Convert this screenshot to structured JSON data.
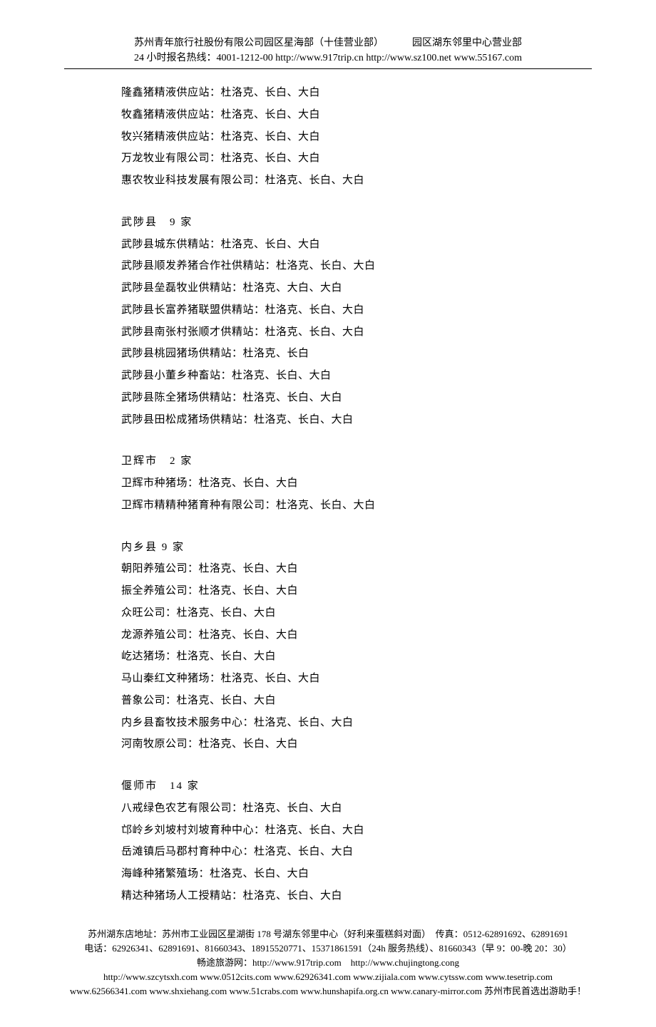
{
  "header": {
    "left": "苏州青年旅行社股份有限公司园区星海部（十佳营业部）",
    "right": "园区湖东邻里中心营业部",
    "line2": "24 小时报名热线：4001-1212-00 http://www.917trip.cn http://www.sz100.net www.55167.com"
  },
  "intro_items": [
    "隆鑫猪精液供应站：杜洛克、长白、大白",
    "牧鑫猪精液供应站：杜洛克、长白、大白",
    "牧兴猪精液供应站：杜洛克、长白、大白",
    "万龙牧业有限公司：杜洛克、长白、大白",
    "惠农牧业科技发展有限公司：杜洛克、长白、大白"
  ],
  "sections": [
    {
      "title": "武陟县　9 家",
      "items": [
        "武陟县城东供精站：杜洛克、长白、大白",
        "武陟县顺发养猪合作社供精站：杜洛克、长白、大白",
        "武陟县垒磊牧业供精站：杜洛克、大白、大白",
        "武陟县长富养猪联盟供精站：杜洛克、长白、大白",
        "武陟县南张村张顺才供精站：杜洛克、长白、大白",
        "武陟县桃园猪场供精站：杜洛克、长白",
        "武陟县小董乡种畜站：杜洛克、长白、大白",
        "武陟县陈全猪场供精站：杜洛克、长白、大白",
        "武陟县田松成猪场供精站：杜洛克、长白、大白"
      ]
    },
    {
      "title": "卫辉市　2 家",
      "items": [
        "卫辉市种猪场：杜洛克、长白、大白",
        "卫辉市精精种猪育种有限公司：杜洛克、长白、大白"
      ]
    },
    {
      "title": "内乡县 9 家",
      "items": [
        "朝阳养殖公司：杜洛克、长白、大白",
        "振全养殖公司：杜洛克、长白、大白",
        "众旺公司：杜洛克、长白、大白",
        "龙源养殖公司：杜洛克、长白、大白",
        "屹达猪场：杜洛克、长白、大白",
        "马山秦红文种猪场：杜洛克、长白、大白",
        "普象公司：杜洛克、长白、大白",
        "内乡县畜牧技术服务中心：杜洛克、长白、大白",
        "河南牧原公司：杜洛克、长白、大白"
      ]
    },
    {
      "title": "偃师市　14 家",
      "items": [
        "八戒绿色农艺有限公司：杜洛克、长白、大白",
        "邙岭乡刘坡村刘坡育种中心：杜洛克、长白、大白",
        "岳滩镇后马郡村育种中心：杜洛克、长白、大白",
        "海峰种猪繁殖场：杜洛克、长白、大白",
        "精达种猪场人工授精站：杜洛克、长白、大白"
      ]
    }
  ],
  "footer": {
    "addr": "苏州湖东店地址：苏州市工业园区星湖街 178 号湖东邻里中心（好利来蛋糕斜对面）　传真：0512-62891692、62891691",
    "tel": "电话：62926341、62891691、81660343、18915520771、15371861591（24h 服务热线）、81660343（早 9：00-晚 20：30）",
    "net": "畅途旅游网：http://www.917trip.com　http://www.chujingtong.cong",
    "links": "http://www.szcytsxh.com www.0512cits.com www.62926341.com www.zijiala.com www.cytssw.com www.tesetrip.com www.62566341.com www.shxiehang.com www.51crabs.com www.hunshapifa.org.cn www.canary-mirror.com 苏州市民首选出游助手！"
  }
}
